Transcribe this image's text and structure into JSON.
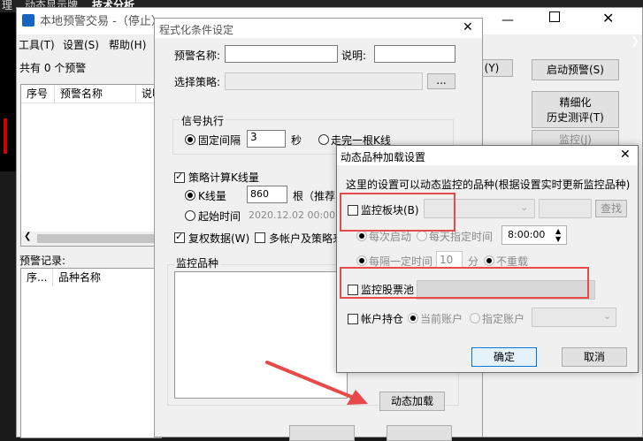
{
  "bg_app": {
    "tabs": [
      "理",
      "动态显示牌",
      "技术分析"
    ]
  },
  "main_window": {
    "title": "本地预警交易 -（停止）",
    "menu": [
      "工具(T)",
      "设置(S)",
      "帮助(H)"
    ],
    "count_text": "共有 0 个预警",
    "table_headers": [
      "序号",
      "预警名称",
      "说明"
    ],
    "record_label": "预警记录:",
    "record_headers": [
      "序...",
      "品种名称"
    ],
    "buttons": {
      "y": "(Y)",
      "start": "启动预警(S)",
      "refine_line1": "精细化",
      "refine_line2": "历史测评(T)",
      "monitor": "监控(J)"
    }
  },
  "cond_dialog": {
    "title": "程式化条件设定",
    "name_label": "预警名称:",
    "desc_label": "说明:",
    "strategy_label": "选择策略:",
    "browse": "...",
    "signal_group": "信号执行",
    "fixed_interval": "固定间隔",
    "interval_value": "3",
    "seconds": "秒",
    "finish_k": "走完一根K线",
    "calc_k": "策略计算K线量",
    "k_count_label": "K线量",
    "k_count_value": "860",
    "k_unit": "根（推荐",
    "start_time_label": "起始时间",
    "start_time_value": "2020.12.02 00:00",
    "restore_rights": "复权数据(W)",
    "multi_account": "多帐户及策略来",
    "monitor_label": "监控品种",
    "dynamic_load": "动态加载"
  },
  "dyn_dialog": {
    "title": "动态品种加载设置",
    "desc": "这里的设置可以动态监控的品种(根据设置实时更新监控品种)",
    "monitor_block": "监控板块(B)",
    "search": "查找",
    "daily_start": "每次启动",
    "daily_specified": "每天指定时间",
    "time_value": "8:00:00",
    "interval_label": "每隔一定时间",
    "interval_value": "10",
    "minute": "分",
    "no_repeat": "不重载",
    "monitor_pool": "监控股票池",
    "account_pos": "帐户持仓",
    "current_account": "当前账户",
    "specified_account": "指定账户",
    "ok": "确定",
    "cancel": "取消"
  },
  "colors": {
    "highlight": "#e84a4a",
    "accent": "#0078d7"
  }
}
